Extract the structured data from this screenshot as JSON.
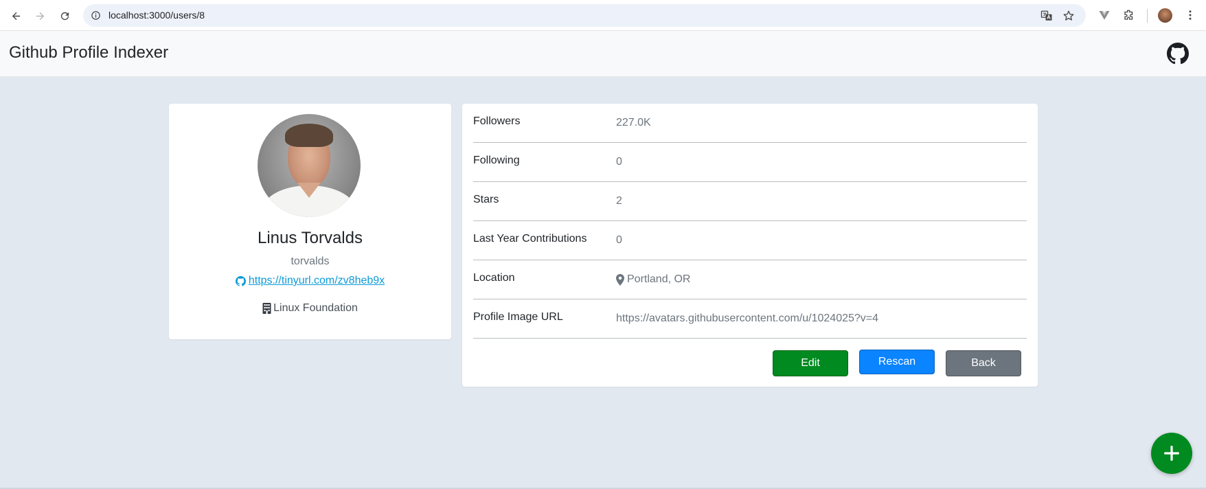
{
  "browser": {
    "url": "localhost:3000/users/8"
  },
  "app": {
    "title": "Github Profile Indexer"
  },
  "profile": {
    "name": "Linus Torvalds",
    "username": "torvalds",
    "github_link": "https://tinyurl.com/zv8heb9x",
    "company": "Linux Foundation"
  },
  "stats": [
    {
      "label": "Followers",
      "value": "227.0K"
    },
    {
      "label": "Following",
      "value": "0"
    },
    {
      "label": "Stars",
      "value": "2"
    },
    {
      "label": "Last Year Contributions",
      "value": "0"
    },
    {
      "label": "Location",
      "value": "Portland, OR",
      "icon": "map-marker-icon"
    },
    {
      "label": "Profile Image URL",
      "value": "https://avatars.githubusercontent.com/u/1024025?v=4"
    }
  ],
  "buttons": {
    "edit": "Edit",
    "rescan": "Rescan",
    "back": "Back"
  },
  "colors": {
    "edit": "#008a1f",
    "rescan": "#0a84ff",
    "back": "#6c757d",
    "fab": "#008a1f",
    "link": "#0d9bd8"
  }
}
